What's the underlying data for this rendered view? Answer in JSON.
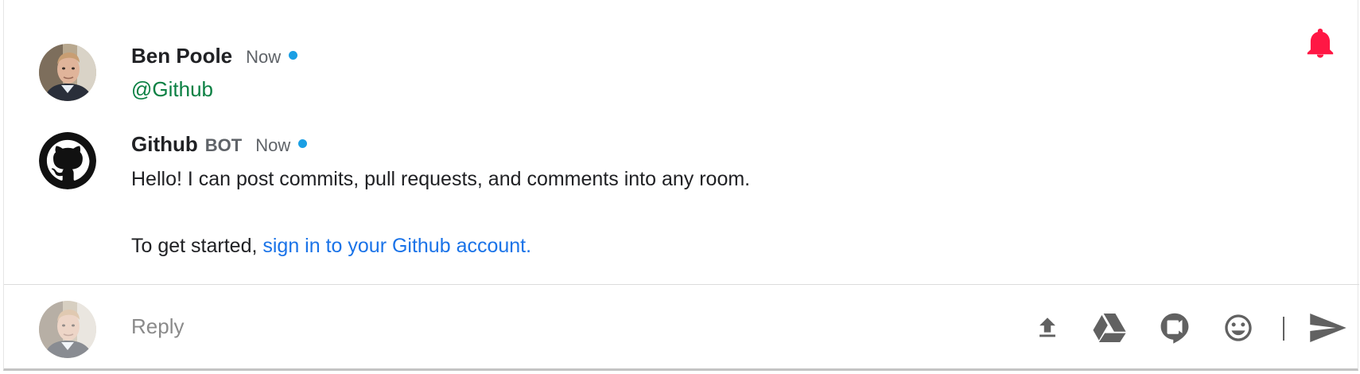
{
  "messages": [
    {
      "author": "Ben Poole",
      "time": "Now",
      "mention": "@Github"
    },
    {
      "author": "Github",
      "tag": "BOT",
      "time": "Now",
      "line1": "Hello! I can post commits, pull requests, and comments into any room.",
      "line2_prefix": "To get started, ",
      "line2_link": "sign in to your Github account."
    }
  ],
  "reply": {
    "placeholder": "Reply"
  },
  "colors": {
    "bell": "#ff1744",
    "presence_dot": "#1a9fe4",
    "mention": "#0b8043",
    "link": "#1a73e8",
    "icon": "#616161"
  },
  "icons": [
    "bell-icon",
    "upload-icon",
    "google-drive-icon",
    "video-call-icon",
    "emoji-icon",
    "send-icon"
  ]
}
